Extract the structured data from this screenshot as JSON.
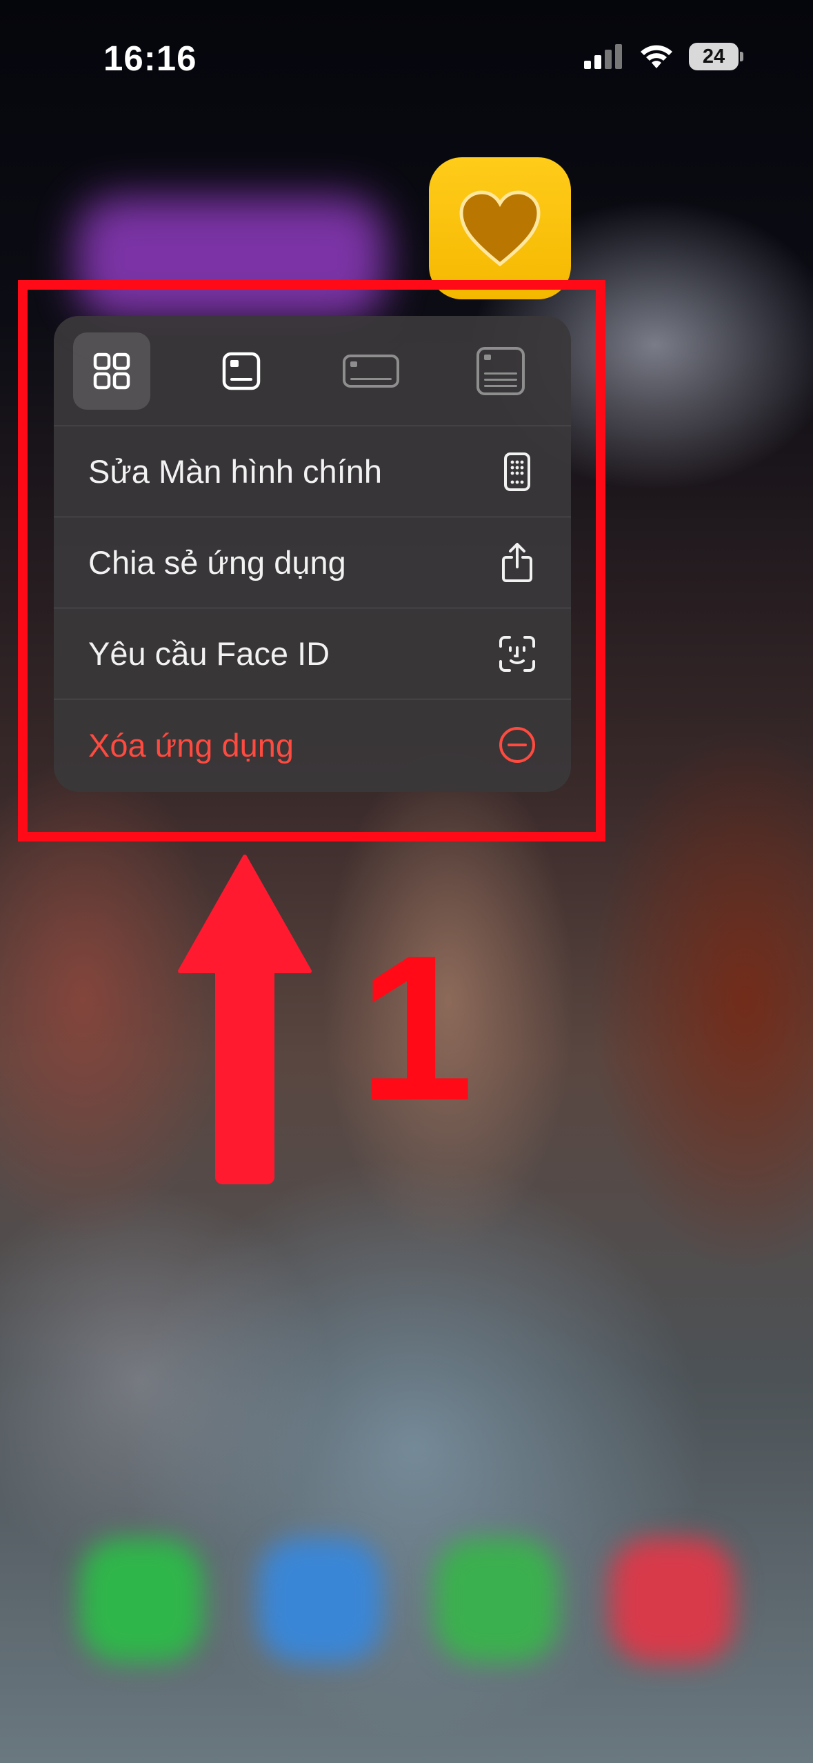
{
  "status_bar": {
    "time": "16:16",
    "battery": "24"
  },
  "app": {
    "name": "Health",
    "icon": "heart-icon",
    "color": "#f5b800"
  },
  "widget_sizes": [
    {
      "name": "size-small-icon",
      "active": true
    },
    {
      "name": "size-medium-icon",
      "active": false
    },
    {
      "name": "size-wide-icon",
      "active": false
    },
    {
      "name": "size-large-icon",
      "active": false
    }
  ],
  "menu": {
    "items": [
      {
        "label": "Sửa Màn hình chính",
        "icon": "phone-edit-icon",
        "destructive": false
      },
      {
        "label": "Chia sẻ ứng dụng",
        "icon": "share-icon",
        "destructive": false
      },
      {
        "label": "Yêu cầu Face ID",
        "icon": "face-id-icon",
        "destructive": false
      },
      {
        "label": "Xóa ứng dụng",
        "icon": "remove-circle-icon",
        "destructive": true
      }
    ]
  },
  "annotation": {
    "number": "1",
    "color": "#ff0a16"
  },
  "colors": {
    "destructive": "#ff4a3f",
    "menu_bg": "#3a383a"
  }
}
